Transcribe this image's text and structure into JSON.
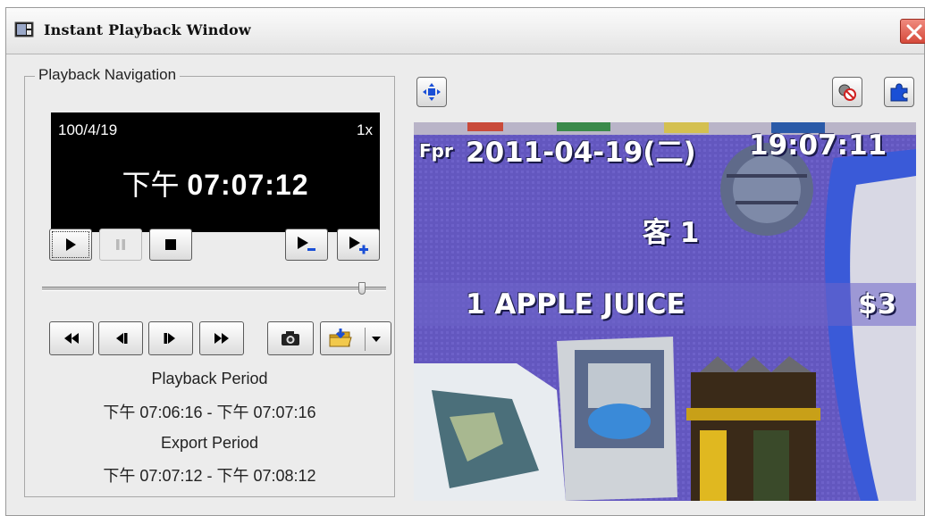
{
  "window": {
    "title": "Instant Playback Window"
  },
  "navigation": {
    "group_label": "Playback Navigation",
    "display": {
      "date": "100/4/19",
      "speed": "1x",
      "time_prefix": "下午",
      "time": "07:07:12"
    },
    "slider_position": 0.94,
    "playback_period_label": "Playback Period",
    "playback_period_value": "下午 07:06:16 - 下午 07:07:16",
    "export_period_label": "Export Period",
    "export_period_value": "下午 07:07:12 - 下午 07:08:12"
  },
  "video": {
    "osd_prefix": "Fpr",
    "osd_date": "2011-04-19(二)",
    "osd_time": "19:07:11",
    "osd_customer": "客 1",
    "osd_item": "1 APPLE JUICE",
    "osd_price": "$3"
  },
  "icons": {
    "play": "play-icon",
    "pause": "pause-icon",
    "stop": "stop-icon",
    "slower": "slower-icon",
    "faster": "faster-icon",
    "rewind": "fast-rewind-icon",
    "step_back": "step-back-icon",
    "step_forward": "step-forward-icon",
    "fast_forward": "fast-forward-icon",
    "snapshot": "camera-icon",
    "export": "export-folder-icon",
    "fit": "fit-window-icon",
    "disable_sound": "no-audio-icon",
    "plugin": "puzzle-icon"
  },
  "colors": {
    "lcd_bg": "#000000",
    "accent_blue": "#1a4fd6",
    "close_red": "#d54a3b"
  }
}
